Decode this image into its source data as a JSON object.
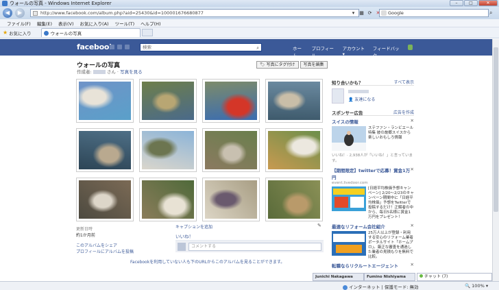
{
  "window": {
    "title": "ウォールの写真 - Windows Internet Explorer",
    "buttons": [
      "–",
      "□",
      "✕"
    ]
  },
  "address": {
    "url": "http://www.facebook.com/album.php?aid=25430&id=100001676680877",
    "search_placeholder": "Google"
  },
  "menu": [
    "ファイル(F)",
    "編集(E)",
    "表示(V)",
    "お気に入り(A)",
    "ツール(T)",
    "ヘルプ(H)"
  ],
  "favorites": {
    "label": "お気に入り",
    "tab": "ウォールの写真"
  },
  "fb": {
    "logo": "facebook",
    "search_placeholder": "検索",
    "nav": [
      "ホーム",
      "プロフィール",
      "アカウント ▾",
      "フィードバック"
    ]
  },
  "album": {
    "title": "ウォールの写真",
    "creator_prefix": "作成者:",
    "creator_suffix": "さん",
    "view_photos": "写真を見る",
    "tag_button": "写真にタグ付け",
    "edit_button": "写真を編集",
    "photos": [
      {
        "name": "photo-baby-frame",
        "colors": [
          "#6f93c8",
          "#e8e3d8",
          "#5aa0c9"
        ]
      },
      {
        "name": "photo-peacock",
        "colors": [
          "#6e7f4a",
          "#b8a673",
          "#4a6a8a"
        ]
      },
      {
        "name": "photo-parrot",
        "colors": [
          "#7d8b6a",
          "#d43628",
          "#3b6db0"
        ]
      },
      {
        "name": "photo-seal-rock",
        "colors": [
          "#6b8aa0",
          "#c9bea8",
          "#3e5a6c"
        ]
      },
      {
        "name": "photo-seal-water",
        "colors": [
          "#4e6f86",
          "#b9a98f",
          "#2d4556"
        ]
      },
      {
        "name": "photo-castle-garden",
        "colors": [
          "#8cb4d8",
          "#6c7550",
          "#dad6cc"
        ]
      },
      {
        "name": "photo-alpaca-rocks",
        "colors": [
          "#6a7f4d",
          "#c8c0b0",
          "#8b7a60"
        ]
      },
      {
        "name": "photo-geese",
        "colors": [
          "#6c8f4b",
          "#ece8df",
          "#c89a50"
        ]
      },
      {
        "name": "photo-llama",
        "colors": [
          "#7b6a55",
          "#ddd6c9",
          "#4d4a40"
        ]
      },
      {
        "name": "photo-white-llama",
        "colors": [
          "#4f6a3a",
          "#e8e2d4",
          "#8a7c5a"
        ]
      },
      {
        "name": "photo-visitors-llama",
        "colors": [
          "#a89e84",
          "#6a5a6e",
          "#dcd5c5"
        ]
      },
      {
        "name": "photo-kangaroo",
        "colors": [
          "#8a9056",
          "#b99a6a",
          "#5a6b3a"
        ]
      }
    ],
    "updated_label": "更新日時",
    "updated_value": "約1か月前",
    "share_link": "このアルバムをシェア",
    "profile_link": "プロフィールにアルバムを投稿",
    "caption_link": "キャプションを追加",
    "like_link": "いいね！",
    "comment_placeholder": "コメントする",
    "share_note": "Facebookを利用していない人も下のURLからこのアルバムを見ることができます。"
  },
  "sidebar": {
    "friends_title": "知り合いかも？",
    "friends_link": "すべて表示",
    "add_friend": "友達になる",
    "sponsor_title": "スポンサー広告",
    "sponsor_link": "広告を作成",
    "ads": [
      {
        "title": "スイスの情報",
        "domain": "",
        "text": "ステファン・ランビエール特集 彼の故郷スイスから楽しいおもしろ情報",
        "like": "いいね！· 2,938人が「いいね！」と言っています。",
        "colors": [
          "#bcd4ea",
          "#ffffff",
          "#333333"
        ]
      },
      {
        "title": "【期間限定】twitterで応募！賞金1万円",
        "domain": "event.livedoor.com",
        "text": "[日経平均株価予想キャンペーン] 2/20～2/23のキャンペーン期間中に「日経平均株価」予想をTwitterで投稿するだけ！正解者の中から、毎日5名様に賞金1万円をプレゼント！",
        "like": "",
        "colors": [
          "#3aa0d8",
          "#f5d020",
          "#e34a2a"
        ]
      },
      {
        "title": "最適なリフォーム会社紹介",
        "domain": "",
        "text": "25万人以上が登録・利用する安心のリフォーム業者ポータルサイト「ホームプロ」。厳正な審査を通過した業者の見積もりを無料で比較。",
        "like": "",
        "colors": [
          "#2b6fb8",
          "#ffffff",
          "#f0a020"
        ]
      },
      {
        "title": "転職ならリクルートエージェント",
        "domain": "",
        "text": "",
        "like": "",
        "colors": []
      }
    ]
  },
  "chat": {
    "user1": "Junichi Nakagawa",
    "user2": "Fumino Nishiyama",
    "chat_label": "チャット (7)"
  },
  "status": {
    "zone": "インターネット | 保護モード: 無効",
    "zoom": "100%"
  }
}
